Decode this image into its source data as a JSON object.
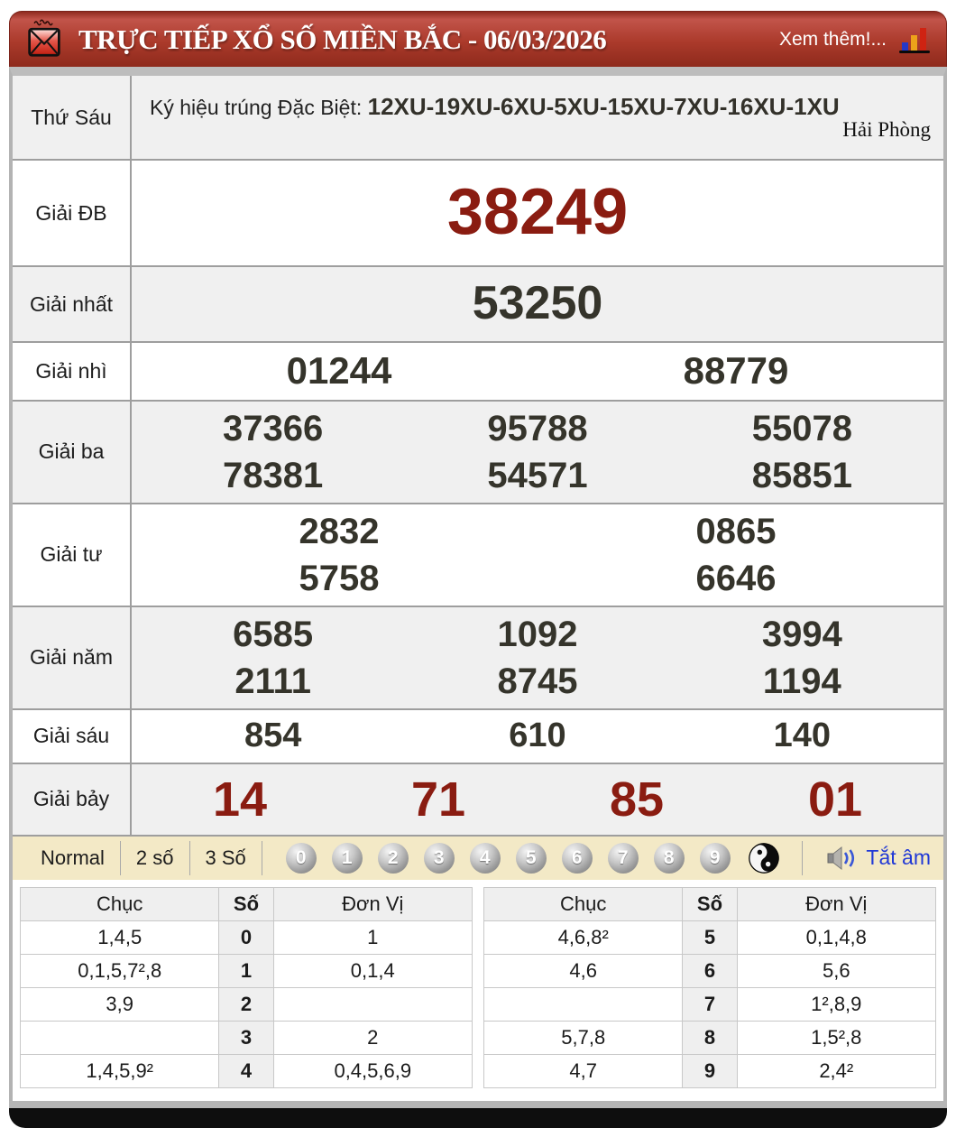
{
  "header": {
    "title": "TRỰC TIẾP XỔ SỐ MIỀN BẮC - 06/03/2026",
    "more_link": "Xem thêm!...",
    "colors": {
      "bar": "#ab3a2b",
      "accent_red": "#8a1c11"
    }
  },
  "results": {
    "day_label": "Thứ Sáu",
    "sign_label": "Ký hiệu trúng Đặc Biệt:",
    "sign_value": "12XU-19XU-6XU-5XU-15XU-7XU-16XU-1XU",
    "province": "Hải Phòng",
    "rows": [
      {
        "label": "Giải ĐB",
        "numbers": [
          [
            "38249"
          ]
        ]
      },
      {
        "label": "Giải nhất",
        "numbers": [
          [
            "53250"
          ]
        ]
      },
      {
        "label": "Giải nhì",
        "numbers": [
          [
            "01244",
            "88779"
          ]
        ]
      },
      {
        "label": "Giải ba",
        "numbers": [
          [
            "37366",
            "95788",
            "55078"
          ],
          [
            "78381",
            "54571",
            "85851"
          ]
        ]
      },
      {
        "label": "Giải tư",
        "numbers": [
          [
            "2832",
            "0865"
          ],
          [
            "5758",
            "6646"
          ]
        ]
      },
      {
        "label": "Giải năm",
        "numbers": [
          [
            "6585",
            "1092",
            "3994"
          ],
          [
            "2111",
            "8745",
            "1194"
          ]
        ]
      },
      {
        "label": "Giải sáu",
        "numbers": [
          [
            "854",
            "610",
            "140"
          ]
        ]
      },
      {
        "label": "Giải bảy",
        "numbers": [
          [
            "14",
            "71",
            "85",
            "01"
          ]
        ]
      }
    ]
  },
  "controls": {
    "modes": [
      "Normal",
      "2 số",
      "3 Số"
    ],
    "balls": [
      "0",
      "1",
      "2",
      "3",
      "4",
      "5",
      "6",
      "7",
      "8",
      "9"
    ],
    "yinyang_icon": "yin-yang-ball",
    "speaker_icon": "speaker-icon",
    "mute_label": "Tắt âm"
  },
  "summary": {
    "tables": [
      {
        "headers": [
          "Chục",
          "Số",
          "Đơn Vị"
        ],
        "rows": [
          [
            "1,4,5",
            "0",
            "1"
          ],
          [
            "0,1,5,7²,8",
            "1",
            "0,1,4"
          ],
          [
            "3,9",
            "2",
            ""
          ],
          [
            "",
            "3",
            "2"
          ],
          [
            "1,4,5,9²",
            "4",
            "0,4,5,6,9"
          ]
        ]
      },
      {
        "headers": [
          "Chục",
          "Số",
          "Đơn Vị"
        ],
        "rows": [
          [
            "4,6,8²",
            "5",
            "0,1,4,8"
          ],
          [
            "4,6",
            "6",
            "5,6"
          ],
          [
            "",
            "7",
            "1²,8,9"
          ],
          [
            "5,7,8",
            "8",
            "1,5²,8"
          ],
          [
            "4,7",
            "9",
            "2,4²"
          ]
        ]
      }
    ]
  }
}
